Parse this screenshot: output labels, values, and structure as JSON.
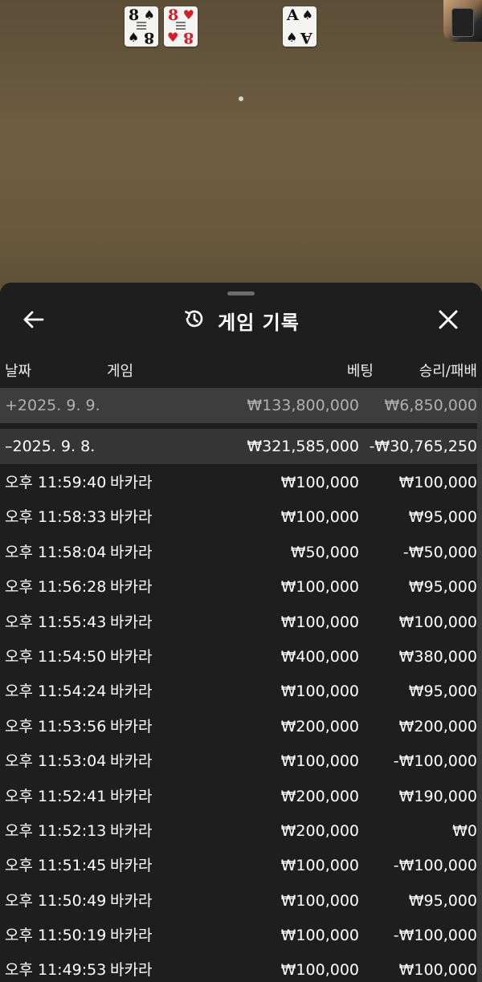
{
  "table": {
    "player_cards": [
      {
        "rank": "8",
        "suit": "♠",
        "color": "black"
      },
      {
        "rank": "8",
        "suit": "♥",
        "color": "red"
      }
    ],
    "banker_cards": [
      {
        "rank": "A",
        "suit": "♠",
        "color": "black"
      }
    ]
  },
  "sheet": {
    "title": "게임 기록",
    "icons": {
      "back": "arrow-left-icon",
      "history": "history-icon",
      "close": "close-icon"
    },
    "columns": {
      "date": "날짜",
      "game": "게임",
      "bet": "베팅",
      "result": "승리/패배"
    },
    "dates": [
      {
        "label": "+2025. 9. 9.",
        "bet": "₩133,800,000",
        "result": "₩6,850,000",
        "expanded": false
      },
      {
        "label": "–2025. 9. 8.",
        "bet": "₩321,585,000",
        "result": "-₩30,765,250",
        "expanded": true
      }
    ],
    "rows": [
      {
        "time": "오후 11:59:40",
        "game": "바카라",
        "bet": "₩100,000",
        "result": "₩100,000"
      },
      {
        "time": "오후 11:58:33",
        "game": "바카라",
        "bet": "₩100,000",
        "result": "₩95,000"
      },
      {
        "time": "오후 11:58:04",
        "game": "바카라",
        "bet": "₩50,000",
        "result": "-₩50,000"
      },
      {
        "time": "오후 11:56:28",
        "game": "바카라",
        "bet": "₩100,000",
        "result": "₩95,000"
      },
      {
        "time": "오후 11:55:43",
        "game": "바카라",
        "bet": "₩100,000",
        "result": "₩100,000"
      },
      {
        "time": "오후 11:54:50",
        "game": "바카라",
        "bet": "₩400,000",
        "result": "₩380,000"
      },
      {
        "time": "오후 11:54:24",
        "game": "바카라",
        "bet": "₩100,000",
        "result": "₩95,000"
      },
      {
        "time": "오후 11:53:56",
        "game": "바카라",
        "bet": "₩200,000",
        "result": "₩200,000"
      },
      {
        "time": "오후 11:53:04",
        "game": "바카라",
        "bet": "₩100,000",
        "result": "-₩100,000"
      },
      {
        "time": "오후 11:52:41",
        "game": "바카라",
        "bet": "₩200,000",
        "result": "₩190,000"
      },
      {
        "time": "오후 11:52:13",
        "game": "바카라",
        "bet": "₩200,000",
        "result": "₩0"
      },
      {
        "time": "오후 11:51:45",
        "game": "바카라",
        "bet": "₩100,000",
        "result": "-₩100,000"
      },
      {
        "time": "오후 11:50:49",
        "game": "바카라",
        "bet": "₩100,000",
        "result": "₩95,000"
      },
      {
        "time": "오후 11:50:19",
        "game": "바카라",
        "bet": "₩100,000",
        "result": "-₩100,000"
      },
      {
        "time": "오후 11:49:53",
        "game": "바카라",
        "bet": "₩100,000",
        "result": "₩100,000"
      }
    ]
  }
}
